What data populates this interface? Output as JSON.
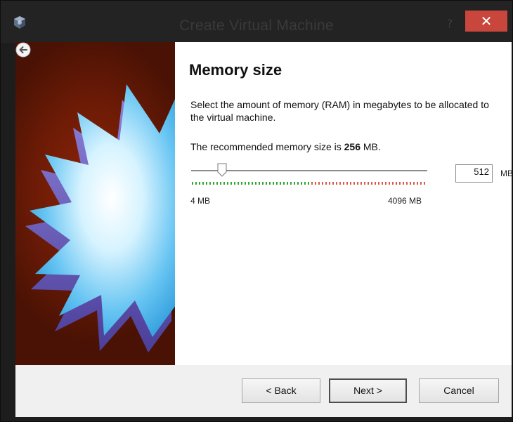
{
  "window": {
    "title": "Create Virtual Machine",
    "help_label": "?",
    "close_label": "✕",
    "app_icon": "virtualbox-cube-icon"
  },
  "navigation": {
    "back_icon": "back-arrow-icon"
  },
  "page": {
    "heading": "Memory size",
    "description": "Select the amount of memory (RAM) in megabytes to be allocated to the virtual machine.",
    "recommended_prefix": "The recommended memory size is ",
    "recommended_value": "256",
    "recommended_suffix": " MB."
  },
  "memory": {
    "value": "512",
    "unit": "MB",
    "min_label": "4 MB",
    "max_label": "4096 MB",
    "min": 4,
    "max": 4096,
    "current": 512,
    "safe_fraction": 0.5
  },
  "buttons": {
    "back": "< Back",
    "next": "Next >",
    "cancel": "Cancel"
  },
  "colors": {
    "close_button": "#c9463d",
    "side_art_background": "#7a1e07",
    "range_safe": "#2fa82f",
    "range_unsafe": "#d85a4a"
  }
}
